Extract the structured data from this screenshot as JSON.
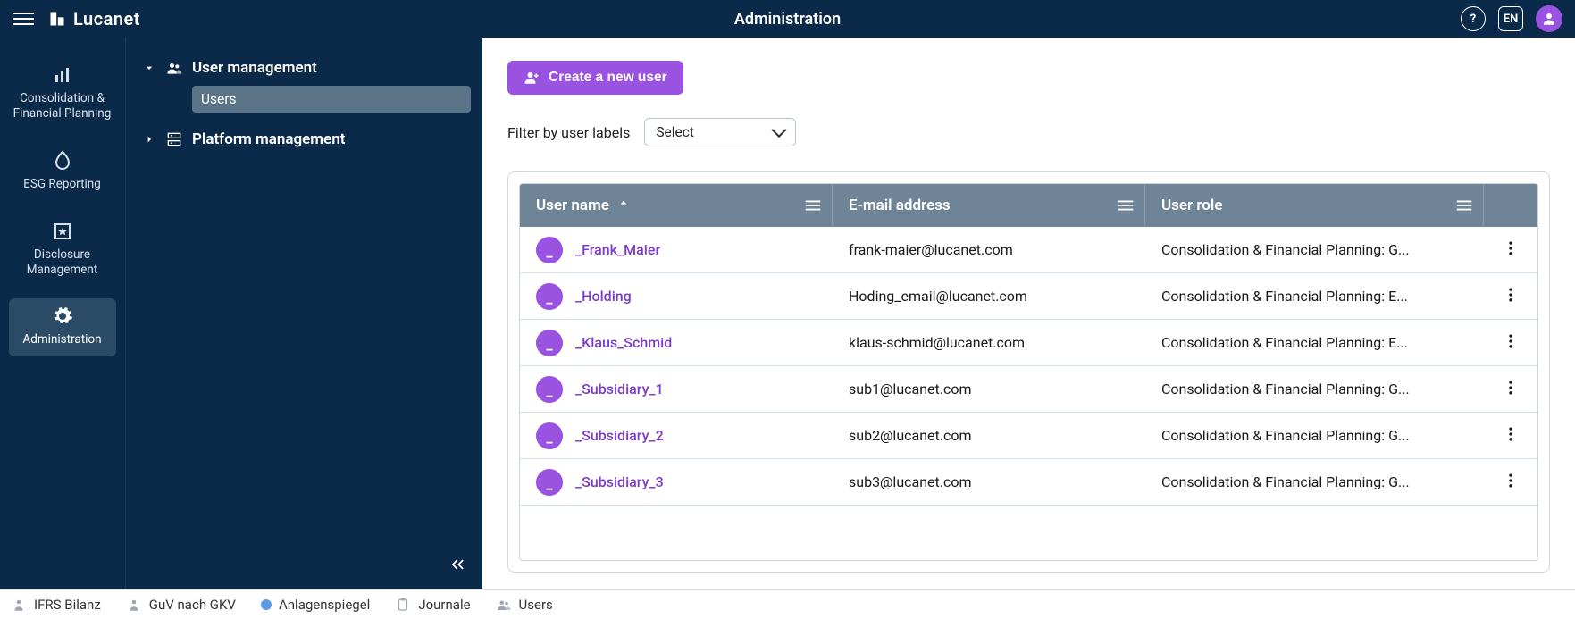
{
  "header": {
    "brand": "Lucanet",
    "title": "Administration",
    "lang": "EN"
  },
  "rail": {
    "items": [
      {
        "id": "cfp",
        "label": "Consolidation & Financial Planning"
      },
      {
        "id": "esg",
        "label": "ESG Reporting"
      },
      {
        "id": "disc",
        "label": "Disclosure Management"
      },
      {
        "id": "admin",
        "label": "Administration"
      }
    ],
    "activeId": "admin"
  },
  "nav": {
    "groups": [
      {
        "id": "um",
        "label": "User management",
        "expanded": true,
        "items": [
          {
            "id": "users",
            "label": "Users",
            "active": true
          }
        ]
      },
      {
        "id": "pm",
        "label": "Platform management",
        "expanded": false,
        "items": []
      }
    ]
  },
  "main": {
    "createButton": "Create a new user",
    "filterLabel": "Filter by user labels",
    "filterSelect": "Select",
    "columns": {
      "username": "User name",
      "email": "E-mail address",
      "role": "User role"
    },
    "rolePrefix": "Consolidation & Financial Planning:",
    "rows": [
      {
        "name": "_Frank_Maier",
        "email": "frank-maier@lucanet.com",
        "roleSuffix": "G..."
      },
      {
        "name": "_Holding",
        "email": "Hoding_email@lucanet.com",
        "roleSuffix": "E..."
      },
      {
        "name": "_Klaus_Schmid",
        "email": "klaus-schmid@lucanet.com",
        "roleSuffix": "E..."
      },
      {
        "name": "_Subsidiary_1",
        "email": "sub1@lucanet.com",
        "roleSuffix": "G..."
      },
      {
        "name": "_Subsidiary_2",
        "email": "sub2@lucanet.com",
        "roleSuffix": "G..."
      },
      {
        "name": "_Subsidiary_3",
        "email": "sub3@lucanet.com",
        "roleSuffix": "G..."
      }
    ]
  },
  "footer": {
    "items": [
      {
        "id": "ifrs",
        "label": "IFRS Bilanz",
        "icon": "person"
      },
      {
        "id": "guv",
        "label": "GuV nach GKV",
        "icon": "person"
      },
      {
        "id": "anlagen",
        "label": "Anlagenspiegel",
        "icon": "dot"
      },
      {
        "id": "journale",
        "label": "Journale",
        "icon": "clipboard"
      },
      {
        "id": "users",
        "label": "Users",
        "icon": "group"
      }
    ]
  }
}
